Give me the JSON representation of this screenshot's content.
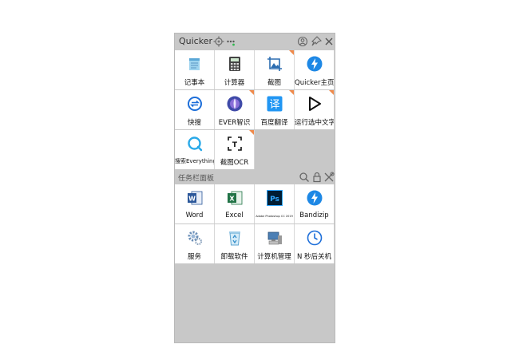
{
  "window": {
    "title": "Quicker",
    "icons": [
      "gear-icon",
      "dots-icon",
      "user-icon",
      "pin-icon",
      "close-icon"
    ]
  },
  "actions": [
    {
      "label": "记事本",
      "icon": "notepad-icon",
      "corner": false
    },
    {
      "label": "计算器",
      "icon": "calculator-icon",
      "corner": false
    },
    {
      "label": "截图",
      "icon": "screenshot-icon",
      "corner": true
    },
    {
      "label": "Quicker主页",
      "icon": "lightning-icon",
      "corner": false
    },
    {
      "label": "快搜",
      "icon": "search-switch-icon",
      "corner": false
    },
    {
      "label": "EVER智识",
      "icon": "ever-icon",
      "corner": true
    },
    {
      "label": "百度翻译",
      "icon": "translate-icon",
      "corner": true
    },
    {
      "label": "运行选中文字",
      "icon": "play-icon",
      "corner": true
    },
    {
      "label": "搜索Everything",
      "icon": "everything-search-icon",
      "corner": false
    },
    {
      "label": "截图OCR",
      "icon": "ocr-icon",
      "corner": true
    }
  ],
  "taskbar": {
    "title": "任务栏面板",
    "icons": [
      "search-icon",
      "lock-icon",
      "tools-icon"
    ],
    "items": [
      {
        "label": "Word",
        "icon": "word-icon"
      },
      {
        "label": "Excel",
        "icon": "excel-icon"
      },
      {
        "label": "Adobe Photoshop CC 2019",
        "icon": "photoshop-icon"
      },
      {
        "label": "Bandizip",
        "icon": "bandizip-icon"
      },
      {
        "label": "服务",
        "icon": "services-gear-icon"
      },
      {
        "label": "卸载软件",
        "icon": "recycle-bin-icon"
      },
      {
        "label": "计算机管理",
        "icon": "computer-management-icon"
      },
      {
        "label": "N 秒后关机",
        "icon": "clock-icon"
      }
    ]
  },
  "colors": {
    "panel_bg": "#c8c8c8",
    "corner_badge": "#f08a4b",
    "accent_blue": "#1e88e5"
  }
}
